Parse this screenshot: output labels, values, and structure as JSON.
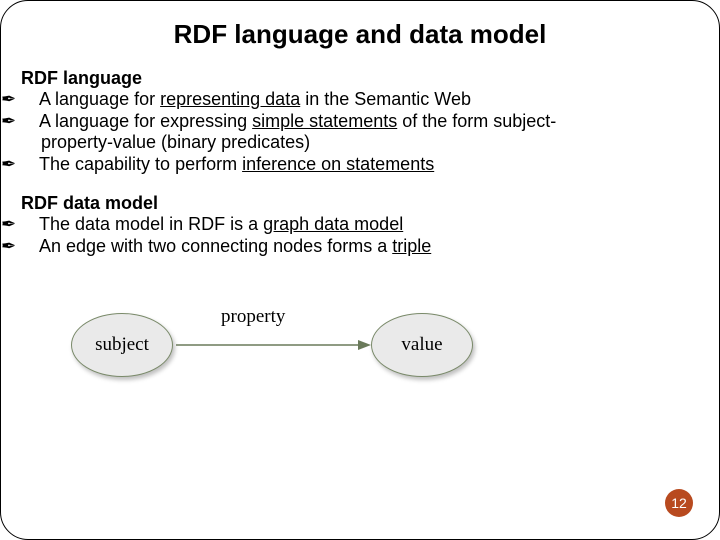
{
  "title": "RDF language and data model",
  "sections": [
    {
      "heading": "RDF language",
      "items": [
        {
          "pre": "A language for ",
          "u": "representing data",
          "post": " in the Semantic Web"
        },
        {
          "pre": "A language for expressing ",
          "u": "simple statements",
          "post": " of the form subject-",
          "cont": "property-value (binary predicates)"
        },
        {
          "pre": "The capability to perform ",
          "u": "inference on statements",
          "post": ""
        }
      ]
    },
    {
      "heading": "RDF data model",
      "items": [
        {
          "pre": "The data model in RDF is a ",
          "u": "graph data model",
          "post": ""
        },
        {
          "pre": "An edge with two connecting nodes forms a ",
          "u": "triple",
          "post": ""
        }
      ]
    }
  ],
  "diagram": {
    "subject": "subject",
    "property": "property",
    "value": "value",
    "arrow_color": "#6a7a5a"
  },
  "page_number": "12",
  "bullet_glyph": "✒"
}
